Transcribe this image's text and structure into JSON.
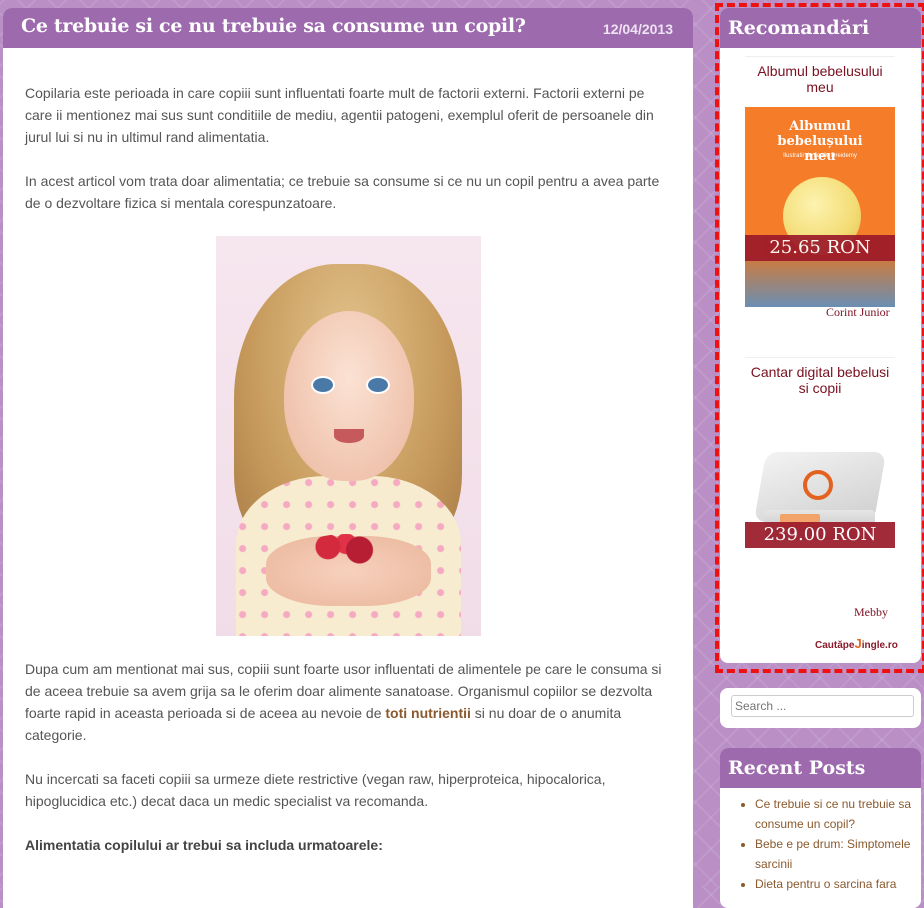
{
  "article": {
    "title": "Ce trebuie si ce nu trebuie sa consume un copil?",
    "date": "12/04/2013",
    "para1": "Copilaria este perioada in care copiii sunt influentati foarte mult de factorii externi. Factorii externi pe care ii mentionez mai sus sunt conditiile de mediu, agentii patogeni, exemplul oferit de persoanele din jurul lui si nu in ultimul rand alimentatia.",
    "para2": "In acest articol vom trata doar alimentatia; ce trebuie sa consume si ce nu un copil pentru a avea parte de o dezvoltare fizica si mentala corespunzatoare.",
    "para3_before": "Dupa cum am mentionat mai sus, copiii sunt foarte usor influentati de alimentele pe care le consuma si de aceea trebuie sa avem grija sa le oferim doar alimente sanatoase. Organismul copiilor se dezvolta foarte rapid in aceasta perioada si de aceea au nevoie de ",
    "para3_link": "toti nutrientii",
    "para3_after": " si nu doar de o anumita categorie.",
    "para4": "Nu incercati sa faceti copiii sa urmeze diete restrictive (vegan raw, hiperproteica, hipocalorica, hipoglucidica etc.) decat daca un medic specialist va recomanda.",
    "bold_line": "Alimentatia copilului ar trebui sa includa urmatoarele:"
  },
  "recommendations": {
    "title": "Recomandări",
    "products": [
      {
        "name": "Albumul bebelusului meu",
        "cover_title": "Albumul bebelușului meu",
        "cover_subtitle": "Ilustratii de Joelle Dreidemy",
        "price": "25.65 RON",
        "vendor": "Corint Junior"
      },
      {
        "name": "Cantar digital bebelusi si copii",
        "price": "239.00 RON",
        "vendor": "Mebby"
      }
    ],
    "cauta_prefix": "Caută",
    "cauta_pe": "pe",
    "cauta_j": "J",
    "cauta_suffix": "ingle.ro"
  },
  "search": {
    "placeholder": "Search ..."
  },
  "recent_posts": {
    "title": "Recent Posts",
    "items": [
      "Ce trebuie si ce nu trebuie sa consume un copil?",
      "Bebe e pe drum: Simptomele sarcinii",
      "Dieta pentru o sarcina fara"
    ]
  },
  "colors": {
    "accent": "#9c6aad",
    "background": "#b98fc6",
    "price_band": "#9b1a2a",
    "highlight_outline": "#ee1111"
  }
}
